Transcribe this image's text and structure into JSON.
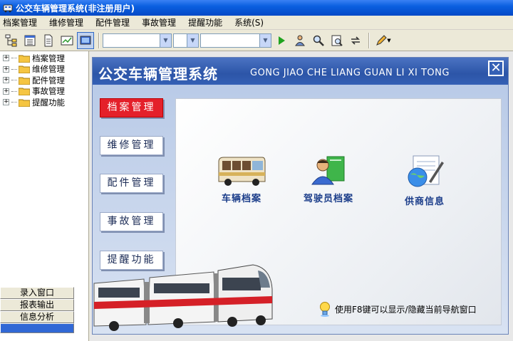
{
  "window": {
    "title": "公交车辆管理系统(非注册用户)"
  },
  "menu": [
    "档案管理",
    "维修管理",
    "配件管理",
    "事故管理",
    "提醒功能",
    "系统(S)"
  ],
  "toolbar": {
    "combo1": "",
    "combo2": "",
    "combo3": ""
  },
  "tree": [
    "档案管理",
    "维修管理",
    "配件管理",
    "事故管理",
    "提醒功能"
  ],
  "left_buttons": [
    "录入窗口",
    "报表输出",
    "信息分析",
    ""
  ],
  "panel": {
    "title_cn": "公交车辆管理系统",
    "title_py": "GONG JIAO CHE LIANG GUAN LI XI TONG",
    "close": "✕",
    "nav": [
      "档案管理",
      "维修管理",
      "配件管理",
      "事故管理",
      "提醒功能"
    ],
    "tiles": [
      "车辆档案",
      "驾驶员档案",
      "供商信息"
    ],
    "hint": "使用F8键可以显示/隐藏当前导航窗口"
  },
  "colors": {
    "title_blue": "#0a5fe0",
    "active_red": "#e4202a",
    "banner_blue": "#2c55a8"
  }
}
